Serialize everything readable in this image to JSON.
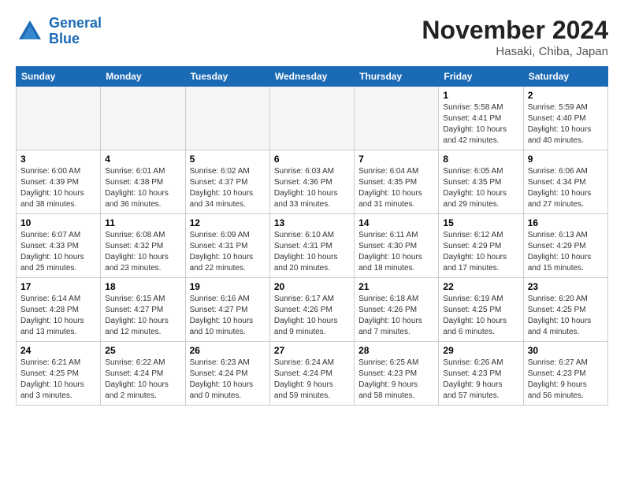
{
  "header": {
    "logo_line1": "General",
    "logo_line2": "Blue",
    "month": "November 2024",
    "location": "Hasaki, Chiba, Japan"
  },
  "weekdays": [
    "Sunday",
    "Monday",
    "Tuesday",
    "Wednesday",
    "Thursday",
    "Friday",
    "Saturday"
  ],
  "weeks": [
    [
      {
        "day": "",
        "info": ""
      },
      {
        "day": "",
        "info": ""
      },
      {
        "day": "",
        "info": ""
      },
      {
        "day": "",
        "info": ""
      },
      {
        "day": "",
        "info": ""
      },
      {
        "day": "1",
        "info": "Sunrise: 5:58 AM\nSunset: 4:41 PM\nDaylight: 10 hours\nand 42 minutes."
      },
      {
        "day": "2",
        "info": "Sunrise: 5:59 AM\nSunset: 4:40 PM\nDaylight: 10 hours\nand 40 minutes."
      }
    ],
    [
      {
        "day": "3",
        "info": "Sunrise: 6:00 AM\nSunset: 4:39 PM\nDaylight: 10 hours\nand 38 minutes."
      },
      {
        "day": "4",
        "info": "Sunrise: 6:01 AM\nSunset: 4:38 PM\nDaylight: 10 hours\nand 36 minutes."
      },
      {
        "day": "5",
        "info": "Sunrise: 6:02 AM\nSunset: 4:37 PM\nDaylight: 10 hours\nand 34 minutes."
      },
      {
        "day": "6",
        "info": "Sunrise: 6:03 AM\nSunset: 4:36 PM\nDaylight: 10 hours\nand 33 minutes."
      },
      {
        "day": "7",
        "info": "Sunrise: 6:04 AM\nSunset: 4:35 PM\nDaylight: 10 hours\nand 31 minutes."
      },
      {
        "day": "8",
        "info": "Sunrise: 6:05 AM\nSunset: 4:35 PM\nDaylight: 10 hours\nand 29 minutes."
      },
      {
        "day": "9",
        "info": "Sunrise: 6:06 AM\nSunset: 4:34 PM\nDaylight: 10 hours\nand 27 minutes."
      }
    ],
    [
      {
        "day": "10",
        "info": "Sunrise: 6:07 AM\nSunset: 4:33 PM\nDaylight: 10 hours\nand 25 minutes."
      },
      {
        "day": "11",
        "info": "Sunrise: 6:08 AM\nSunset: 4:32 PM\nDaylight: 10 hours\nand 23 minutes."
      },
      {
        "day": "12",
        "info": "Sunrise: 6:09 AM\nSunset: 4:31 PM\nDaylight: 10 hours\nand 22 minutes."
      },
      {
        "day": "13",
        "info": "Sunrise: 6:10 AM\nSunset: 4:31 PM\nDaylight: 10 hours\nand 20 minutes."
      },
      {
        "day": "14",
        "info": "Sunrise: 6:11 AM\nSunset: 4:30 PM\nDaylight: 10 hours\nand 18 minutes."
      },
      {
        "day": "15",
        "info": "Sunrise: 6:12 AM\nSunset: 4:29 PM\nDaylight: 10 hours\nand 17 minutes."
      },
      {
        "day": "16",
        "info": "Sunrise: 6:13 AM\nSunset: 4:29 PM\nDaylight: 10 hours\nand 15 minutes."
      }
    ],
    [
      {
        "day": "17",
        "info": "Sunrise: 6:14 AM\nSunset: 4:28 PM\nDaylight: 10 hours\nand 13 minutes."
      },
      {
        "day": "18",
        "info": "Sunrise: 6:15 AM\nSunset: 4:27 PM\nDaylight: 10 hours\nand 12 minutes."
      },
      {
        "day": "19",
        "info": "Sunrise: 6:16 AM\nSunset: 4:27 PM\nDaylight: 10 hours\nand 10 minutes."
      },
      {
        "day": "20",
        "info": "Sunrise: 6:17 AM\nSunset: 4:26 PM\nDaylight: 10 hours\nand 9 minutes."
      },
      {
        "day": "21",
        "info": "Sunrise: 6:18 AM\nSunset: 4:26 PM\nDaylight: 10 hours\nand 7 minutes."
      },
      {
        "day": "22",
        "info": "Sunrise: 6:19 AM\nSunset: 4:25 PM\nDaylight: 10 hours\nand 6 minutes."
      },
      {
        "day": "23",
        "info": "Sunrise: 6:20 AM\nSunset: 4:25 PM\nDaylight: 10 hours\nand 4 minutes."
      }
    ],
    [
      {
        "day": "24",
        "info": "Sunrise: 6:21 AM\nSunset: 4:25 PM\nDaylight: 10 hours\nand 3 minutes."
      },
      {
        "day": "25",
        "info": "Sunrise: 6:22 AM\nSunset: 4:24 PM\nDaylight: 10 hours\nand 2 minutes."
      },
      {
        "day": "26",
        "info": "Sunrise: 6:23 AM\nSunset: 4:24 PM\nDaylight: 10 hours\nand 0 minutes."
      },
      {
        "day": "27",
        "info": "Sunrise: 6:24 AM\nSunset: 4:24 PM\nDaylight: 9 hours\nand 59 minutes."
      },
      {
        "day": "28",
        "info": "Sunrise: 6:25 AM\nSunset: 4:23 PM\nDaylight: 9 hours\nand 58 minutes."
      },
      {
        "day": "29",
        "info": "Sunrise: 6:26 AM\nSunset: 4:23 PM\nDaylight: 9 hours\nand 57 minutes."
      },
      {
        "day": "30",
        "info": "Sunrise: 6:27 AM\nSunset: 4:23 PM\nDaylight: 9 hours\nand 56 minutes."
      }
    ]
  ]
}
